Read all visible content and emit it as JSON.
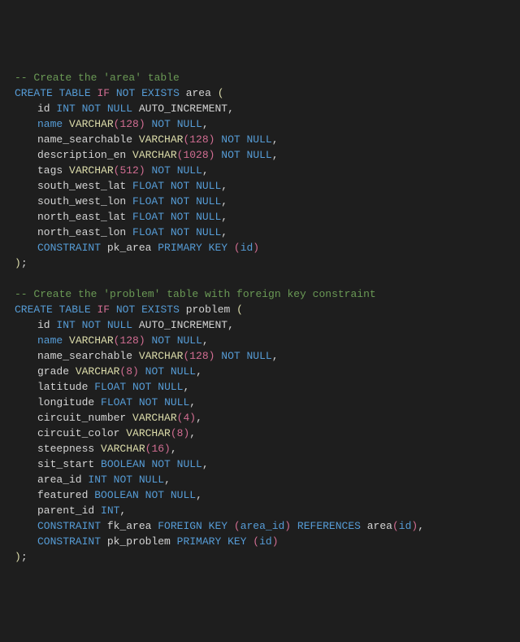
{
  "lines": [
    {
      "cls": "",
      "tokens": [
        {
          "t": "-- Create the 'area' table",
          "c": "comment"
        }
      ]
    },
    {
      "cls": "",
      "tokens": [
        {
          "t": "CREATE",
          "c": "kw"
        },
        {
          "t": " ",
          "c": ""
        },
        {
          "t": "TABLE",
          "c": "kw"
        },
        {
          "t": " ",
          "c": ""
        },
        {
          "t": "IF",
          "c": "pink"
        },
        {
          "t": " ",
          "c": ""
        },
        {
          "t": "NOT",
          "c": "kw"
        },
        {
          "t": " ",
          "c": ""
        },
        {
          "t": "EXISTS",
          "c": "kw"
        },
        {
          "t": " area ",
          "c": "ident"
        },
        {
          "t": "(",
          "c": "paren"
        }
      ]
    },
    {
      "cls": "indent1",
      "tokens": [
        {
          "t": "id ",
          "c": "ident"
        },
        {
          "t": "INT",
          "c": "kw"
        },
        {
          "t": " ",
          "c": ""
        },
        {
          "t": "NOT",
          "c": "kw"
        },
        {
          "t": " ",
          "c": ""
        },
        {
          "t": "NULL",
          "c": "kw"
        },
        {
          "t": " AUTO_INCREMENT,",
          "c": "ident"
        }
      ]
    },
    {
      "cls": "indent1",
      "tokens": [
        {
          "t": "name",
          "c": "kw"
        },
        {
          "t": " ",
          "c": ""
        },
        {
          "t": "VARCHAR",
          "c": "func"
        },
        {
          "t": "(",
          "c": "pink"
        },
        {
          "t": "128",
          "c": "num"
        },
        {
          "t": ")",
          "c": "pink"
        },
        {
          "t": " ",
          "c": ""
        },
        {
          "t": "NOT",
          "c": "kw"
        },
        {
          "t": " ",
          "c": ""
        },
        {
          "t": "NULL",
          "c": "kw"
        },
        {
          "t": ",",
          "c": "ident"
        }
      ]
    },
    {
      "cls": "indent1",
      "tokens": [
        {
          "t": "name_searchable ",
          "c": "ident"
        },
        {
          "t": "VARCHAR",
          "c": "func"
        },
        {
          "t": "(",
          "c": "pink"
        },
        {
          "t": "128",
          "c": "num"
        },
        {
          "t": ")",
          "c": "pink"
        },
        {
          "t": " ",
          "c": ""
        },
        {
          "t": "NOT",
          "c": "kw"
        },
        {
          "t": " ",
          "c": ""
        },
        {
          "t": "NULL",
          "c": "kw"
        },
        {
          "t": ",",
          "c": "ident"
        }
      ]
    },
    {
      "cls": "indent1",
      "tokens": [
        {
          "t": "description_en ",
          "c": "ident"
        },
        {
          "t": "VARCHAR",
          "c": "func"
        },
        {
          "t": "(",
          "c": "pink"
        },
        {
          "t": "1028",
          "c": "num"
        },
        {
          "t": ")",
          "c": "pink"
        },
        {
          "t": " ",
          "c": ""
        },
        {
          "t": "NOT",
          "c": "kw"
        },
        {
          "t": " ",
          "c": ""
        },
        {
          "t": "NULL",
          "c": "kw"
        },
        {
          "t": ",",
          "c": "ident"
        }
      ]
    },
    {
      "cls": "indent1",
      "tokens": [
        {
          "t": "tags ",
          "c": "ident"
        },
        {
          "t": "VARCHAR",
          "c": "func"
        },
        {
          "t": "(",
          "c": "pink"
        },
        {
          "t": "512",
          "c": "num"
        },
        {
          "t": ")",
          "c": "pink"
        },
        {
          "t": " ",
          "c": ""
        },
        {
          "t": "NOT",
          "c": "kw"
        },
        {
          "t": " ",
          "c": ""
        },
        {
          "t": "NULL",
          "c": "kw"
        },
        {
          "t": ",",
          "c": "ident"
        }
      ]
    },
    {
      "cls": "indent1",
      "tokens": [
        {
          "t": "south_west_lat ",
          "c": "ident"
        },
        {
          "t": "FLOAT",
          "c": "kw"
        },
        {
          "t": " ",
          "c": ""
        },
        {
          "t": "NOT",
          "c": "kw"
        },
        {
          "t": " ",
          "c": ""
        },
        {
          "t": "NULL",
          "c": "kw"
        },
        {
          "t": ",",
          "c": "ident"
        }
      ]
    },
    {
      "cls": "indent1",
      "tokens": [
        {
          "t": "south_west_lon ",
          "c": "ident"
        },
        {
          "t": "FLOAT",
          "c": "kw"
        },
        {
          "t": " ",
          "c": ""
        },
        {
          "t": "NOT",
          "c": "kw"
        },
        {
          "t": " ",
          "c": ""
        },
        {
          "t": "NULL",
          "c": "kw"
        },
        {
          "t": ",",
          "c": "ident"
        }
      ]
    },
    {
      "cls": "indent1",
      "tokens": [
        {
          "t": "north_east_lat ",
          "c": "ident"
        },
        {
          "t": "FLOAT",
          "c": "kw"
        },
        {
          "t": " ",
          "c": ""
        },
        {
          "t": "NOT",
          "c": "kw"
        },
        {
          "t": " ",
          "c": ""
        },
        {
          "t": "NULL",
          "c": "kw"
        },
        {
          "t": ",",
          "c": "ident"
        }
      ]
    },
    {
      "cls": "indent1",
      "tokens": [
        {
          "t": "north_east_lon ",
          "c": "ident"
        },
        {
          "t": "FLOAT",
          "c": "kw"
        },
        {
          "t": " ",
          "c": ""
        },
        {
          "t": "NOT",
          "c": "kw"
        },
        {
          "t": " ",
          "c": ""
        },
        {
          "t": "NULL",
          "c": "kw"
        },
        {
          "t": ",",
          "c": "ident"
        }
      ]
    },
    {
      "cls": "indent1",
      "tokens": [
        {
          "t": "CONSTRAINT",
          "c": "kw"
        },
        {
          "t": " pk_area ",
          "c": "ident"
        },
        {
          "t": "PRIMARY",
          "c": "kw"
        },
        {
          "t": " ",
          "c": ""
        },
        {
          "t": "KEY",
          "c": "kw"
        },
        {
          "t": " ",
          "c": ""
        },
        {
          "t": "(",
          "c": "pink"
        },
        {
          "t": "id",
          "c": "kw"
        },
        {
          "t": ")",
          "c": "pink"
        }
      ]
    },
    {
      "cls": "",
      "tokens": [
        {
          "t": ")",
          "c": "paren"
        },
        {
          "t": ";",
          "c": "ident"
        }
      ]
    },
    {
      "cls": "",
      "tokens": [
        {
          "t": " ",
          "c": ""
        }
      ]
    },
    {
      "cls": "",
      "tokens": [
        {
          "t": "-- Create the 'problem' table with foreign key constraint",
          "c": "comment"
        }
      ]
    },
    {
      "cls": "",
      "tokens": [
        {
          "t": "CREATE",
          "c": "kw"
        },
        {
          "t": " ",
          "c": ""
        },
        {
          "t": "TABLE",
          "c": "kw"
        },
        {
          "t": " ",
          "c": ""
        },
        {
          "t": "IF",
          "c": "pink"
        },
        {
          "t": " ",
          "c": ""
        },
        {
          "t": "NOT",
          "c": "kw"
        },
        {
          "t": " ",
          "c": ""
        },
        {
          "t": "EXISTS",
          "c": "kw"
        },
        {
          "t": " problem ",
          "c": "ident"
        },
        {
          "t": "(",
          "c": "paren"
        }
      ]
    },
    {
      "cls": "indent1",
      "tokens": [
        {
          "t": "id ",
          "c": "ident"
        },
        {
          "t": "INT",
          "c": "kw"
        },
        {
          "t": " ",
          "c": ""
        },
        {
          "t": "NOT",
          "c": "kw"
        },
        {
          "t": " ",
          "c": ""
        },
        {
          "t": "NULL",
          "c": "kw"
        },
        {
          "t": " AUTO_INCREMENT,",
          "c": "ident"
        }
      ]
    },
    {
      "cls": "indent1",
      "tokens": [
        {
          "t": "name",
          "c": "kw"
        },
        {
          "t": " ",
          "c": ""
        },
        {
          "t": "VARCHAR",
          "c": "func"
        },
        {
          "t": "(",
          "c": "pink"
        },
        {
          "t": "128",
          "c": "num"
        },
        {
          "t": ")",
          "c": "pink"
        },
        {
          "t": " ",
          "c": ""
        },
        {
          "t": "NOT",
          "c": "kw"
        },
        {
          "t": " ",
          "c": ""
        },
        {
          "t": "NULL",
          "c": "kw"
        },
        {
          "t": ",",
          "c": "ident"
        }
      ]
    },
    {
      "cls": "indent1",
      "tokens": [
        {
          "t": "name_searchable ",
          "c": "ident"
        },
        {
          "t": "VARCHAR",
          "c": "func"
        },
        {
          "t": "(",
          "c": "pink"
        },
        {
          "t": "128",
          "c": "num"
        },
        {
          "t": ")",
          "c": "pink"
        },
        {
          "t": " ",
          "c": ""
        },
        {
          "t": "NOT",
          "c": "kw"
        },
        {
          "t": " ",
          "c": ""
        },
        {
          "t": "NULL",
          "c": "kw"
        },
        {
          "t": ",",
          "c": "ident"
        }
      ]
    },
    {
      "cls": "indent1",
      "tokens": [
        {
          "t": "grade ",
          "c": "ident"
        },
        {
          "t": "VARCHAR",
          "c": "func"
        },
        {
          "t": "(",
          "c": "pink"
        },
        {
          "t": "8",
          "c": "num"
        },
        {
          "t": ")",
          "c": "pink"
        },
        {
          "t": " ",
          "c": ""
        },
        {
          "t": "NOT",
          "c": "kw"
        },
        {
          "t": " ",
          "c": ""
        },
        {
          "t": "NULL",
          "c": "kw"
        },
        {
          "t": ",",
          "c": "ident"
        }
      ]
    },
    {
      "cls": "indent1",
      "tokens": [
        {
          "t": "latitude ",
          "c": "ident"
        },
        {
          "t": "FLOAT",
          "c": "kw"
        },
        {
          "t": " ",
          "c": ""
        },
        {
          "t": "NOT",
          "c": "kw"
        },
        {
          "t": " ",
          "c": ""
        },
        {
          "t": "NULL",
          "c": "kw"
        },
        {
          "t": ",",
          "c": "ident"
        }
      ]
    },
    {
      "cls": "indent1",
      "tokens": [
        {
          "t": "longitude ",
          "c": "ident"
        },
        {
          "t": "FLOAT",
          "c": "kw"
        },
        {
          "t": " ",
          "c": ""
        },
        {
          "t": "NOT",
          "c": "kw"
        },
        {
          "t": " ",
          "c": ""
        },
        {
          "t": "NULL",
          "c": "kw"
        },
        {
          "t": ",",
          "c": "ident"
        }
      ]
    },
    {
      "cls": "indent1",
      "tokens": [
        {
          "t": "circuit_number ",
          "c": "ident"
        },
        {
          "t": "VARCHAR",
          "c": "func"
        },
        {
          "t": "(",
          "c": "pink"
        },
        {
          "t": "4",
          "c": "num"
        },
        {
          "t": ")",
          "c": "pink"
        },
        {
          "t": ",",
          "c": "ident"
        }
      ]
    },
    {
      "cls": "indent1",
      "tokens": [
        {
          "t": "circuit_color ",
          "c": "ident"
        },
        {
          "t": "VARCHAR",
          "c": "func"
        },
        {
          "t": "(",
          "c": "pink"
        },
        {
          "t": "8",
          "c": "num"
        },
        {
          "t": ")",
          "c": "pink"
        },
        {
          "t": ",",
          "c": "ident"
        }
      ]
    },
    {
      "cls": "indent1",
      "tokens": [
        {
          "t": "steepness ",
          "c": "ident"
        },
        {
          "t": "VARCHAR",
          "c": "func"
        },
        {
          "t": "(",
          "c": "pink"
        },
        {
          "t": "16",
          "c": "num"
        },
        {
          "t": ")",
          "c": "pink"
        },
        {
          "t": ",",
          "c": "ident"
        }
      ]
    },
    {
      "cls": "indent1",
      "tokens": [
        {
          "t": "sit_start ",
          "c": "ident"
        },
        {
          "t": "BOOLEAN",
          "c": "kw"
        },
        {
          "t": " ",
          "c": ""
        },
        {
          "t": "NOT",
          "c": "kw"
        },
        {
          "t": " ",
          "c": ""
        },
        {
          "t": "NULL",
          "c": "kw"
        },
        {
          "t": ",",
          "c": "ident"
        }
      ]
    },
    {
      "cls": "indent1",
      "tokens": [
        {
          "t": "area_id ",
          "c": "ident"
        },
        {
          "t": "INT",
          "c": "kw"
        },
        {
          "t": " ",
          "c": ""
        },
        {
          "t": "NOT",
          "c": "kw"
        },
        {
          "t": " ",
          "c": ""
        },
        {
          "t": "NULL",
          "c": "kw"
        },
        {
          "t": ",",
          "c": "ident"
        }
      ]
    },
    {
      "cls": "indent1",
      "tokens": [
        {
          "t": "featured ",
          "c": "ident"
        },
        {
          "t": "BOOLEAN",
          "c": "kw"
        },
        {
          "t": " ",
          "c": ""
        },
        {
          "t": "NOT",
          "c": "kw"
        },
        {
          "t": " ",
          "c": ""
        },
        {
          "t": "NULL",
          "c": "kw"
        },
        {
          "t": ",",
          "c": "ident"
        }
      ]
    },
    {
      "cls": "indent1",
      "tokens": [
        {
          "t": "parent_id ",
          "c": "ident"
        },
        {
          "t": "INT",
          "c": "kw"
        },
        {
          "t": ",",
          "c": "ident"
        }
      ]
    },
    {
      "cls": "indent1",
      "tokens": [
        {
          "t": "CONSTRAINT",
          "c": "kw"
        },
        {
          "t": " fk_area ",
          "c": "ident"
        },
        {
          "t": "FOREIGN",
          "c": "kw"
        },
        {
          "t": " ",
          "c": ""
        },
        {
          "t": "KEY",
          "c": "kw"
        },
        {
          "t": " ",
          "c": ""
        },
        {
          "t": "(",
          "c": "pink"
        },
        {
          "t": "area_id",
          "c": "kw"
        },
        {
          "t": ")",
          "c": "pink"
        },
        {
          "t": " ",
          "c": ""
        },
        {
          "t": "REFERENCES",
          "c": "kw"
        },
        {
          "t": " area",
          "c": "ident"
        },
        {
          "t": "(",
          "c": "pink"
        },
        {
          "t": "id",
          "c": "kw"
        },
        {
          "t": ")",
          "c": "pink"
        },
        {
          "t": ",",
          "c": "ident"
        }
      ]
    },
    {
      "cls": "indent1",
      "tokens": [
        {
          "t": "CONSTRAINT",
          "c": "kw"
        },
        {
          "t": " pk_problem ",
          "c": "ident"
        },
        {
          "t": "PRIMARY",
          "c": "kw"
        },
        {
          "t": " ",
          "c": ""
        },
        {
          "t": "KEY",
          "c": "kw"
        },
        {
          "t": " ",
          "c": ""
        },
        {
          "t": "(",
          "c": "pink"
        },
        {
          "t": "id",
          "c": "kw"
        },
        {
          "t": ")",
          "c": "pink"
        }
      ]
    },
    {
      "cls": "",
      "tokens": [
        {
          "t": ")",
          "c": "paren"
        },
        {
          "t": ";",
          "c": "ident"
        }
      ]
    }
  ]
}
